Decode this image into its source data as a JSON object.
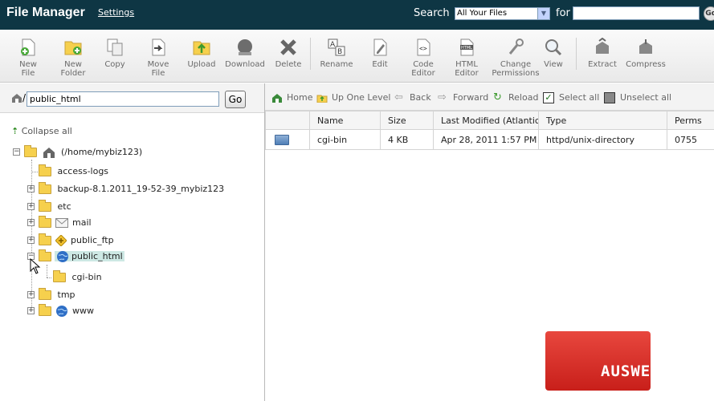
{
  "header": {
    "title": "File Manager",
    "settings_label": "Settings",
    "search_label": "Search",
    "search_scope": "All Your Files",
    "for_label": "for",
    "search_query": "",
    "search_go_label": "Go"
  },
  "toolbar": [
    {
      "label": "New File",
      "icon": "new-file-icon"
    },
    {
      "label": "New Folder",
      "icon": "new-folder-icon"
    },
    {
      "label": "Copy",
      "icon": "copy-icon"
    },
    {
      "label": "Move File",
      "icon": "move-file-icon"
    },
    {
      "label": "Upload",
      "icon": "upload-icon"
    },
    {
      "label": "Download",
      "icon": "download-icon"
    },
    {
      "label": "Delete",
      "icon": "delete-icon"
    },
    {
      "label": "Rename",
      "icon": "rename-icon"
    },
    {
      "label": "Edit",
      "icon": "edit-icon"
    },
    {
      "label": "Code Editor",
      "icon": "code-editor-icon"
    },
    {
      "label": "HTML Editor",
      "icon": "html-editor-icon"
    },
    {
      "label": "Change Permissions",
      "icon": "permissions-icon"
    },
    {
      "label": "View",
      "icon": "view-icon"
    },
    {
      "label": "Extract",
      "icon": "extract-icon"
    },
    {
      "label": "Compress",
      "icon": "compress-icon"
    }
  ],
  "path_bar": {
    "slash": "/",
    "path_value": "public_html",
    "go_label": "Go"
  },
  "tree": {
    "collapse_all_label": "Collapse all",
    "root_label": "(/home/mybiz123)",
    "items": [
      {
        "label": "access-logs",
        "expander": ""
      },
      {
        "label": "backup-8.1.2011_19-52-39_mybiz123",
        "expander": "+"
      },
      {
        "label": "etc",
        "expander": "+"
      },
      {
        "label": "mail",
        "expander": "+"
      },
      {
        "label": "public_ftp",
        "expander": "+"
      },
      {
        "label": "public_html",
        "expander": "−"
      },
      {
        "label": "cgi-bin",
        "expander": ""
      },
      {
        "label": "tmp",
        "expander": "+"
      },
      {
        "label": "www",
        "expander": "+"
      }
    ]
  },
  "nav": {
    "home": "Home",
    "up_one_level": "Up One Level",
    "back": "Back",
    "forward": "Forward",
    "reload": "Reload",
    "select_all": "Select all",
    "unselect_all": "Unselect all"
  },
  "table": {
    "headers": [
      "",
      "Name",
      "Size",
      "Last Modified (Atlantic Daylight Time)",
      "Type",
      "Perms"
    ],
    "rows": [
      {
        "name": "cgi-bin",
        "size": "4 KB",
        "modified": "Apr 28, 2011 1:57 PM",
        "type": "httpd/unix-directory",
        "perms": "0755"
      }
    ]
  },
  "watermark": "AUSWEB",
  "colors": {
    "header_bg": "#0e3644",
    "selected_bg": "#cde8e4",
    "watermark": "#d7312b"
  }
}
